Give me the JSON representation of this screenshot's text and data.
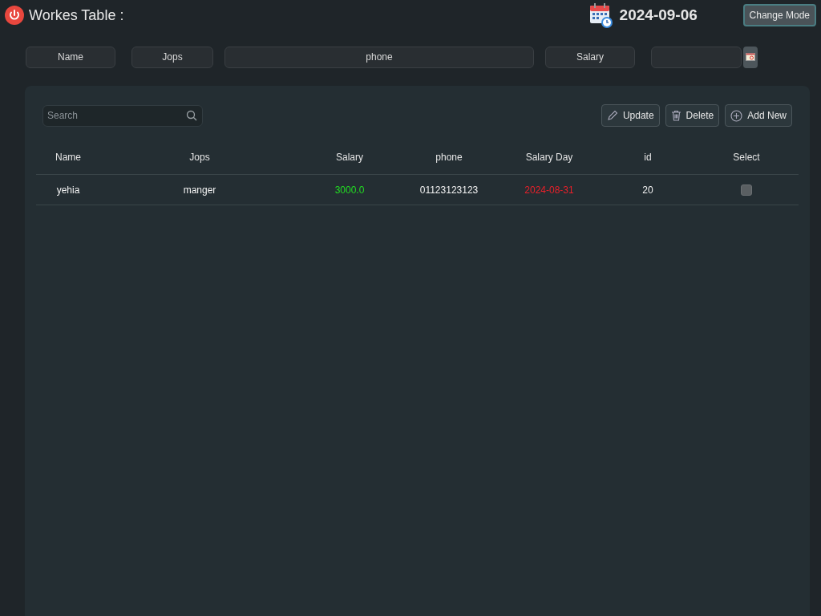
{
  "header": {
    "title": "Workes Table :",
    "date": "2024-09-06",
    "mode_button": "Change Mode"
  },
  "form_fields": [
    {
      "kind": "text",
      "placeholder": "Name"
    },
    {
      "kind": "text",
      "placeholder": "Jops"
    },
    {
      "kind": "text",
      "placeholder": "phone"
    },
    {
      "kind": "text",
      "placeholder": "Salary"
    },
    {
      "kind": "date"
    }
  ],
  "toolbar": {
    "search_placeholder": "Search",
    "buttons": [
      {
        "kind": "edit",
        "label": "Update"
      },
      {
        "kind": "delete",
        "label": "Delete"
      },
      {
        "kind": "add",
        "label": "Add New"
      }
    ]
  },
  "table": {
    "columns": [
      "Name",
      "Jops",
      "Salary",
      "phone",
      "Salary Day",
      "id",
      "Select"
    ],
    "rows": [
      {
        "name": "yehia",
        "jops": "manger",
        "salary": "3000.0",
        "phone": "01123123123",
        "salary_day": "2024-08-31",
        "id": "20",
        "selected": false
      }
    ]
  }
}
